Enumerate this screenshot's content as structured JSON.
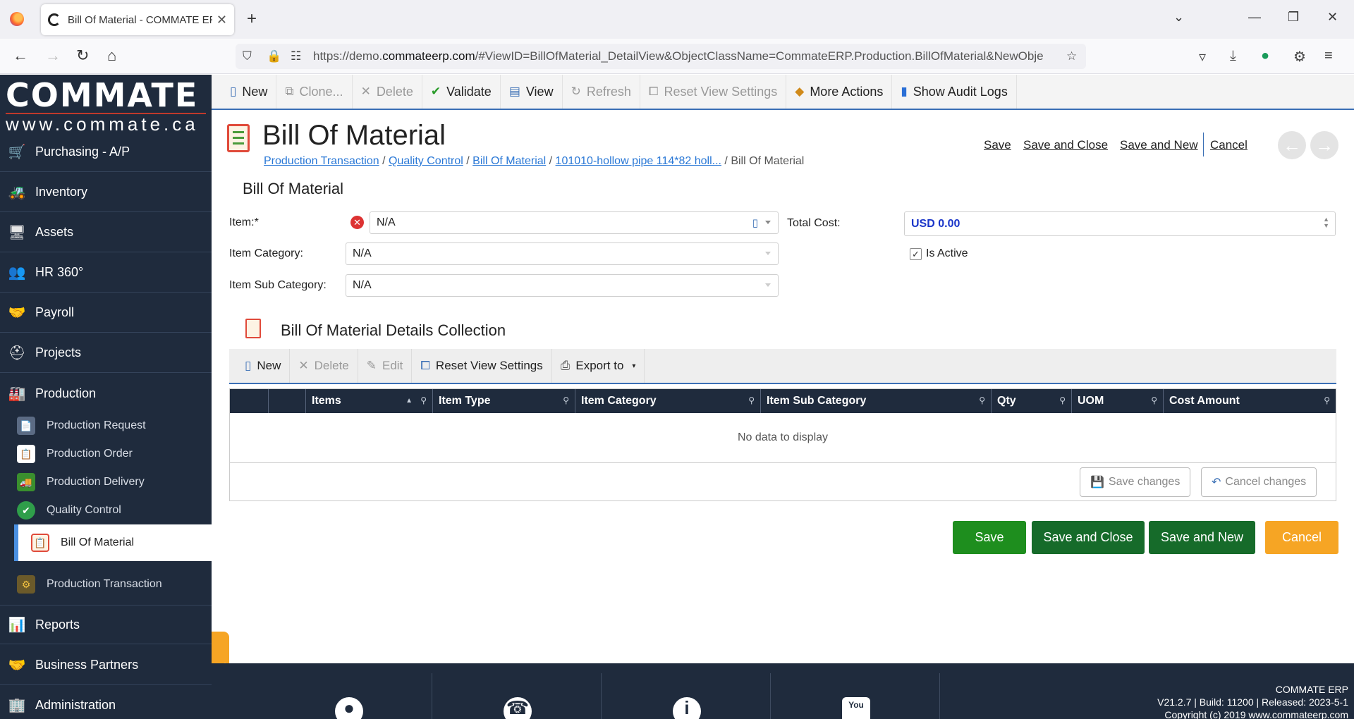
{
  "browser": {
    "tab_title": "Bill Of Material - COMMATE ERP",
    "url_prefix": "https://demo.",
    "url_domain": "commateerp.com",
    "url_rest": "/#ViewID=BillOfMaterial_DetailView&ObjectClassName=CommateERP.Production.BillOfMaterial&NewObje"
  },
  "logo": {
    "main": "COMMATE",
    "sub": "www.commate.ca"
  },
  "sidebar": {
    "items": [
      {
        "label": "Purchasing - A/P",
        "icon": "cart-icon",
        "glyph": "🛒"
      },
      {
        "label": "Inventory",
        "icon": "forklift-icon",
        "glyph": "🚜"
      },
      {
        "label": "Assets",
        "icon": "monitor-icon",
        "glyph": "🖥"
      },
      {
        "label": "HR 360°",
        "icon": "people-icon",
        "glyph": "👥"
      },
      {
        "label": "Payroll",
        "icon": "payroll-icon",
        "glyph": "🤝"
      },
      {
        "label": "Projects",
        "icon": "hardhat-icon",
        "glyph": "⛑"
      },
      {
        "label": "Production",
        "icon": "factory-icon",
        "glyph": "🏭"
      }
    ],
    "sub_items": [
      {
        "label": "Production Request",
        "icon": "request-doc-icon",
        "glyph": "📄"
      },
      {
        "label": "Production Order",
        "icon": "order-doc-icon",
        "glyph": "📋"
      },
      {
        "label": "Production Delivery",
        "icon": "truck-icon",
        "glyph": "🚚"
      },
      {
        "label": "Quality Control",
        "icon": "shield-check-icon",
        "glyph": "✔"
      },
      {
        "label": "Bill Of Material",
        "icon": "clipboard-icon",
        "glyph": "📋"
      },
      {
        "label": "Production Transaction",
        "icon": "transaction-icon",
        "glyph": "⚙"
      }
    ],
    "bottom_items": [
      {
        "label": "Reports",
        "icon": "reports-icon",
        "glyph": "📊"
      },
      {
        "label": "Business Partners",
        "icon": "partners-icon",
        "glyph": "🤝"
      },
      {
        "label": "Administration",
        "icon": "admin-icon",
        "glyph": "🏢"
      }
    ]
  },
  "toolbar": {
    "new": "New",
    "clone": "Clone...",
    "delete": "Delete",
    "validate": "Validate",
    "view": "View",
    "refresh": "Refresh",
    "reset": "Reset View Settings",
    "more": "More Actions",
    "audit": "Show Audit Logs"
  },
  "page": {
    "title": "Bill Of Material",
    "breadcrumb": [
      "Production Transaction",
      "Quality Control",
      "Bill Of Material",
      "101010-hollow pipe 114*82 holl..."
    ],
    "breadcrumb_current": "Bill Of Material",
    "links": {
      "save": "Save",
      "save_close": "Save and Close",
      "save_new": "Save and New",
      "cancel": "Cancel"
    }
  },
  "form": {
    "section_title": "Bill Of Material",
    "item_label": "Item:*",
    "item_value": "N/A",
    "category_label": "Item Category:",
    "category_value": "N/A",
    "subcategory_label": "Item Sub Category:",
    "subcategory_value": "N/A",
    "total_cost_label": "Total Cost:",
    "total_cost_value": "USD 0.00",
    "is_active_label": "Is Active",
    "is_active": true
  },
  "collection": {
    "title": "Bill Of Material Details Collection",
    "toolbar": {
      "new": "New",
      "delete": "Delete",
      "edit": "Edit",
      "reset": "Reset View Settings",
      "export": "Export to"
    },
    "columns": [
      "Items",
      "Item Type",
      "Item Category",
      "Item Sub Category",
      "Qty",
      "UOM",
      "Cost Amount"
    ],
    "empty_text": "No data to display",
    "save_changes": "Save changes",
    "cancel_changes": "Cancel changes"
  },
  "actions": {
    "save": "Save",
    "save_close": "Save and Close",
    "save_new": "Save and New",
    "cancel": "Cancel",
    "colors": {
      "save": "#1e8e1e",
      "save_close": "#166b2a",
      "save_new": "#166b2a",
      "cancel": "#f6a524"
    }
  },
  "footer": {
    "company": "COMMATE ERP",
    "version": "V21.2.7 | Build: 11200 | Released: 2023-5-1",
    "copyright": "Copyright (c) 2019 www.commateerp.com"
  }
}
